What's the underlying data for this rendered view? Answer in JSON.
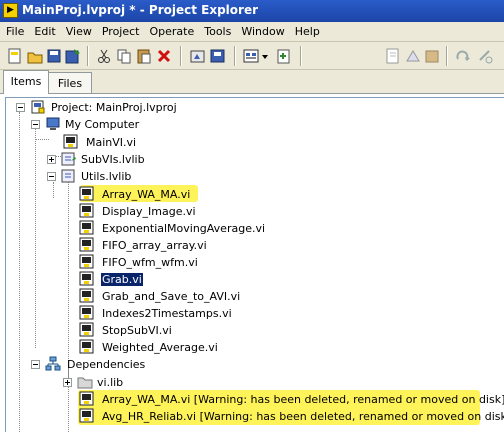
{
  "window": {
    "title": "MainProj.lvproj * - Project Explorer"
  },
  "menu": [
    "File",
    "Edit",
    "View",
    "Project",
    "Operate",
    "Tools",
    "Window",
    "Help"
  ],
  "toolbar": {
    "icons": [
      "new-icon",
      "open-icon",
      "save-all-icon",
      "save-icon",
      "cut-icon",
      "copy-icon",
      "paste-icon",
      "delete-icon",
      "build-icon",
      "build-all-icon",
      "view-options-icon",
      "dropdown-icon",
      "add-file-icon",
      "add-folder-icon",
      "unknown-icon",
      "undo-icon",
      "redo-icon",
      "refresh-icon"
    ]
  },
  "tabs": [
    {
      "label": "Items",
      "active": true
    },
    {
      "label": "Files",
      "active": false
    }
  ],
  "tree": {
    "project": "Project: MainProj.lvproj",
    "my_computer": "My Computer",
    "mainvi": "MainVI.vi",
    "subvis": "SubVIs.lvlib",
    "utils": "Utils.lvlib",
    "utils_items": [
      "Array_WA_MA.vi",
      "Display_Image.vi",
      "ExponentialMovingAverage.vi",
      "FIFO_array_array.vi",
      "FIFO_wfm_wfm.vi",
      "Grab.vi",
      "Grab_and_Save_to_AVI.vi",
      "Indexes2Timestamps.vi",
      "StopSubVI.vi",
      "Weighted_Average.vi"
    ],
    "dependencies": "Dependencies",
    "vilib": "vi.lib",
    "dep_items": [
      "Array_WA_MA.vi  [Warning:  has been deleted, renamed or moved on disk]",
      "Avg_HR_Reliab.vi  [Warning:  has been deleted, renamed or moved on disk]"
    ]
  },
  "colors": {
    "title_bar": "#1d45a8",
    "chrome": "#ece9d8",
    "highlight": "#fff35a",
    "selection": "#0a246a"
  }
}
